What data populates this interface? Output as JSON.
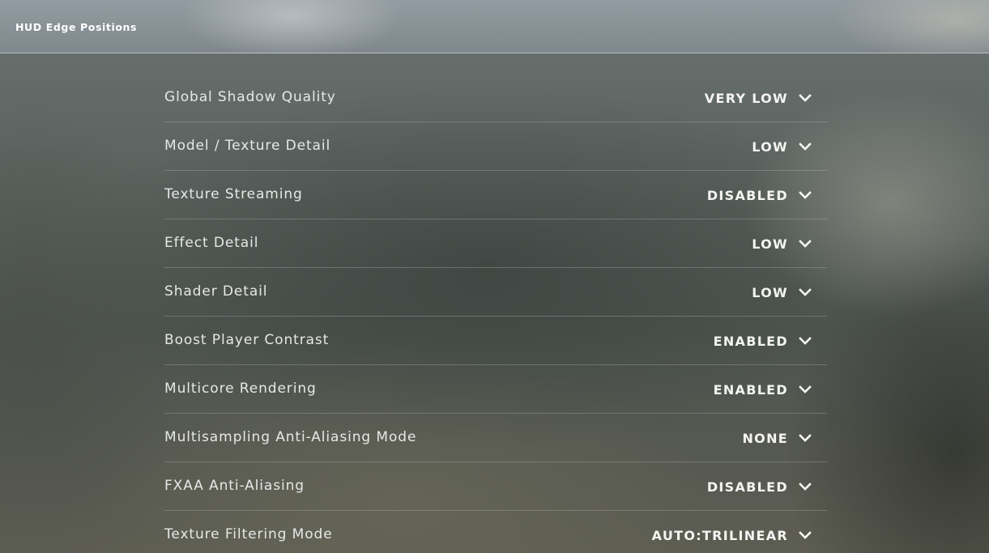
{
  "header": {
    "title": "HUD Edge Positions"
  },
  "settings": [
    {
      "label": "Global Shadow Quality",
      "value": "VERY LOW"
    },
    {
      "label": "Model / Texture Detail",
      "value": "LOW"
    },
    {
      "label": "Texture Streaming",
      "value": "DISABLED"
    },
    {
      "label": "Effect Detail",
      "value": "LOW"
    },
    {
      "label": "Shader Detail",
      "value": "LOW"
    },
    {
      "label": "Boost Player Contrast",
      "value": "ENABLED"
    },
    {
      "label": "Multicore Rendering",
      "value": "ENABLED"
    },
    {
      "label": "Multisampling Anti-Aliasing Mode",
      "value": "NONE"
    },
    {
      "label": "FXAA Anti-Aliasing",
      "value": "DISABLED"
    },
    {
      "label": "Texture Filtering Mode",
      "value": "AUTO:TRILINEAR"
    }
  ],
  "icons": {
    "dropdown": "chevron-down-icon"
  },
  "colors": {
    "text": "#e6e8e6",
    "value_text": "#f4f4f2",
    "divider": "rgba(200,205,205,0.28)"
  }
}
